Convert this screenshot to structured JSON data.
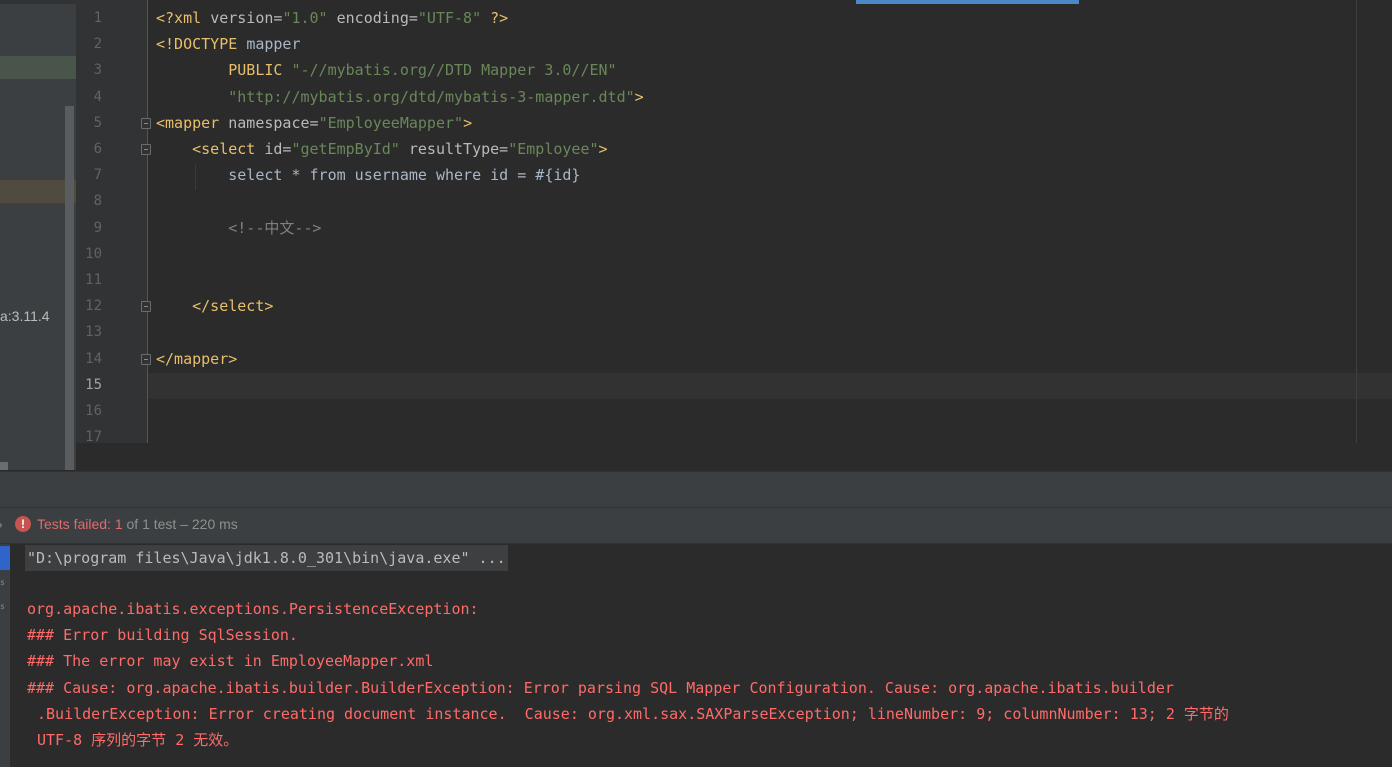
{
  "project_panel": {
    "version_label": "a:3.11.4"
  },
  "editor": {
    "current_line": "15",
    "lines": [
      {
        "n": "1",
        "segments": [
          [
            "t-tag",
            "<?xml "
          ],
          [
            "t-attr",
            "version="
          ],
          [
            "t-val",
            "\"1.0\""
          ],
          [
            "t-attr",
            " encoding="
          ],
          [
            "t-val",
            "\"UTF-8\""
          ],
          [
            "t-tag",
            " ?>"
          ]
        ]
      },
      {
        "n": "2",
        "segments": [
          [
            "t-tag",
            "<!DOCTYPE "
          ],
          [
            "t-text",
            "mapper"
          ]
        ]
      },
      {
        "n": "3",
        "segments": [
          [
            "t-text",
            "        "
          ],
          [
            "t-tag",
            "PUBLIC "
          ],
          [
            "t-val",
            "\"-//mybatis.org//DTD Mapper 3.0//EN\""
          ]
        ]
      },
      {
        "n": "4",
        "segments": [
          [
            "t-text",
            "        "
          ],
          [
            "t-val",
            "\"http://mybatis.org/dtd/mybatis-3-mapper.dtd\""
          ],
          [
            "t-tag",
            ">"
          ]
        ]
      },
      {
        "n": "5",
        "fold": true,
        "segments": [
          [
            "t-tag",
            "<mapper "
          ],
          [
            "t-attr",
            "namespace="
          ],
          [
            "t-val",
            "\"EmployeeMapper\""
          ],
          [
            "t-tag",
            ">"
          ]
        ]
      },
      {
        "n": "6",
        "fold": true,
        "segments": [
          [
            "t-text",
            "    "
          ],
          [
            "t-tag",
            "<select "
          ],
          [
            "t-attr",
            "id="
          ],
          [
            "t-val",
            "\"getEmpById\""
          ],
          [
            "t-attr",
            " resultType="
          ],
          [
            "t-val",
            "\"Employee\""
          ],
          [
            "t-tag",
            ">"
          ]
        ]
      },
      {
        "n": "7",
        "segments": [
          [
            "t-text",
            "        select * from username where id = #{id}"
          ]
        ]
      },
      {
        "n": "8",
        "segments": []
      },
      {
        "n": "9",
        "segments": [
          [
            "t-text",
            "        "
          ],
          [
            "t-comment",
            "<!--中文-->"
          ]
        ]
      },
      {
        "n": "10",
        "segments": []
      },
      {
        "n": "11",
        "segments": []
      },
      {
        "n": "12",
        "fold": true,
        "segments": [
          [
            "t-text",
            "    "
          ],
          [
            "t-tag",
            "</select>"
          ]
        ]
      },
      {
        "n": "13",
        "segments": []
      },
      {
        "n": "14",
        "fold": true,
        "segments": [
          [
            "t-tag",
            "</mapper>"
          ]
        ]
      },
      {
        "n": "15",
        "segments": []
      },
      {
        "n": "16",
        "segments": []
      },
      {
        "n": "17",
        "segments": []
      }
    ]
  },
  "run_panel": {
    "status_failed": "Tests failed: ",
    "failed_count": "1",
    "status_rest": " of 1 test – 220 ms",
    "fail_icon_glyph": "!"
  },
  "console": {
    "command": "\"D:\\program files\\Java\\jdk1.8.0_301\\bin\\java.exe\" ...",
    "lines": [
      "org.apache.ibatis.exceptions.PersistenceException: ",
      "### Error building SqlSession.",
      "### The error may exist in EmployeeMapper.xml",
      "### Cause: org.apache.ibatis.builder.BuilderException: Error parsing SQL Mapper Configuration. Cause: org.apache.ibatis.builder"
    ],
    "continuation": [
      ".BuilderException: Error creating document instance.  Cause: org.xml.sax.SAXParseException; lineNumber: 9; columnNumber: 13; 2 字节的",
      "UTF-8 序列的字节 2 无效。"
    ]
  },
  "colors": {
    "background": "#2b2b2b",
    "gutter": "#313335",
    "xml_tag": "#e8bf6a",
    "xml_value": "#6a8759",
    "comment": "#808080",
    "error_text": "#ff6b68",
    "failed_status": "#e06c6c",
    "selection_blue": "#4a88c7"
  }
}
